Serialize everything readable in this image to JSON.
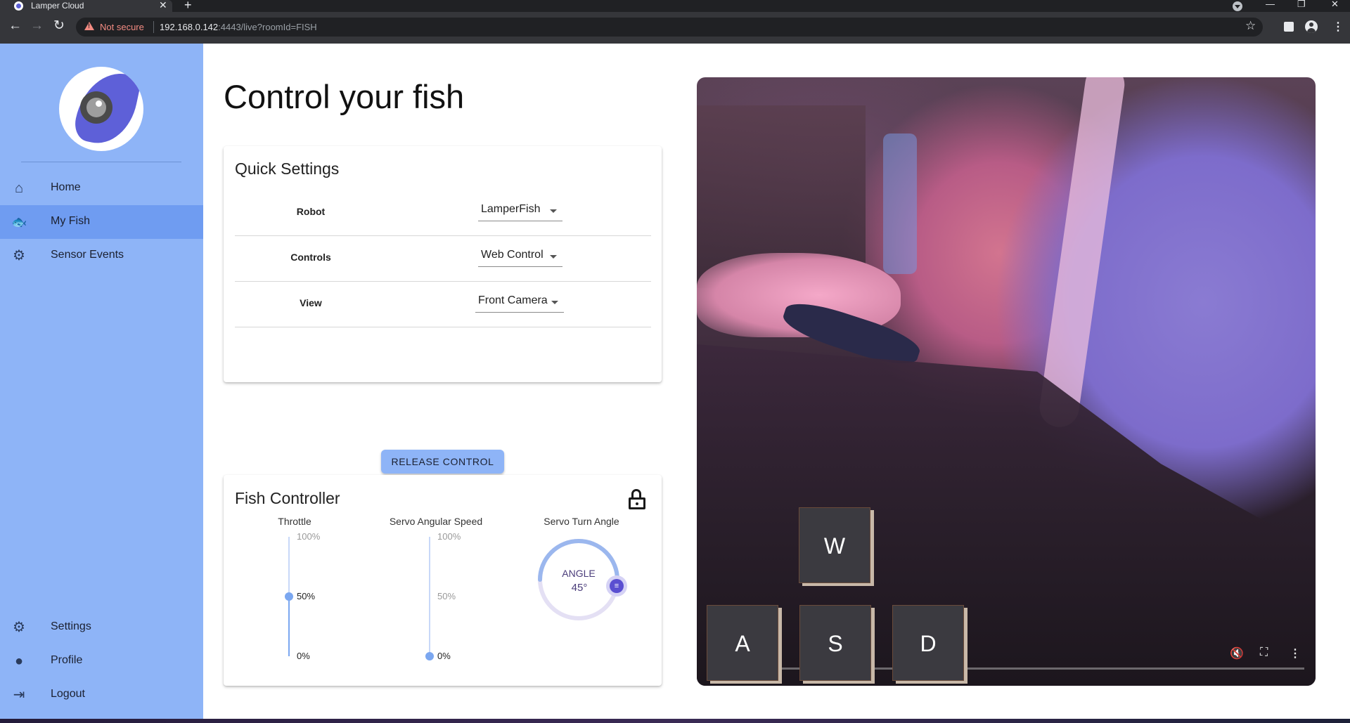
{
  "browser": {
    "tab_title": "Lamper Cloud",
    "tab_close": "✕",
    "new_tab": "+",
    "back": "←",
    "forward": "→",
    "reload": "↻",
    "security_label": "Not secure",
    "url_host": "192.168.0.142",
    "url_rest": ":4443/live?roomId=FISH",
    "minimize": "—",
    "restore": "❐",
    "close": "✕",
    "star": "☆",
    "menu": "⋮"
  },
  "sidebar": {
    "items": [
      {
        "label": "Home",
        "icon": "home-icon",
        "glyph": "⌂"
      },
      {
        "label": "My Fish",
        "icon": "fish-icon",
        "glyph": "🐟",
        "active": true
      },
      {
        "label": "Sensor Events",
        "icon": "sensor-icon",
        "glyph": "⚙"
      }
    ],
    "bottom_items": [
      {
        "label": "Settings",
        "icon": "gear-icon",
        "glyph": "⚙"
      },
      {
        "label": "Profile",
        "icon": "account-icon",
        "glyph": "●"
      },
      {
        "label": "Logout",
        "icon": "logout-icon",
        "glyph": "⇥"
      }
    ]
  },
  "main": {
    "title": "Control your fish"
  },
  "quick_settings": {
    "title": "Quick Settings",
    "rows": [
      {
        "label": "Robot",
        "value": "LamperFish"
      },
      {
        "label": "Controls",
        "value": "Web Control"
      },
      {
        "label": "View",
        "value": "Front Camera"
      }
    ]
  },
  "release_button": "RELEASE CONTROL",
  "fish_controller": {
    "title": "Fish Controller",
    "throttle": {
      "label": "Throttle",
      "value_percent": 50,
      "ticks": [
        "100%",
        "50%",
        "0%"
      ]
    },
    "servo_speed": {
      "label": "Servo Angular Speed",
      "value_percent": 0,
      "ticks": [
        "100%",
        "50%",
        "0%"
      ]
    },
    "servo_angle": {
      "label": "Servo Turn Angle",
      "dial_title": "ANGLE",
      "value": "45°",
      "knob_glyph": "≡",
      "fraction": 0.5
    }
  },
  "keys": {
    "w": "W",
    "a": "A",
    "s": "S",
    "d": "D"
  },
  "video_controls": {
    "mute": "🔇",
    "fullscreen": "⛶",
    "more": "⋮"
  },
  "colors": {
    "sidebar": "#8eb4f7",
    "sidebar_active": "#6f9cf1",
    "accent": "#7ba7f0",
    "dial_knob": "#5a4fd1"
  }
}
